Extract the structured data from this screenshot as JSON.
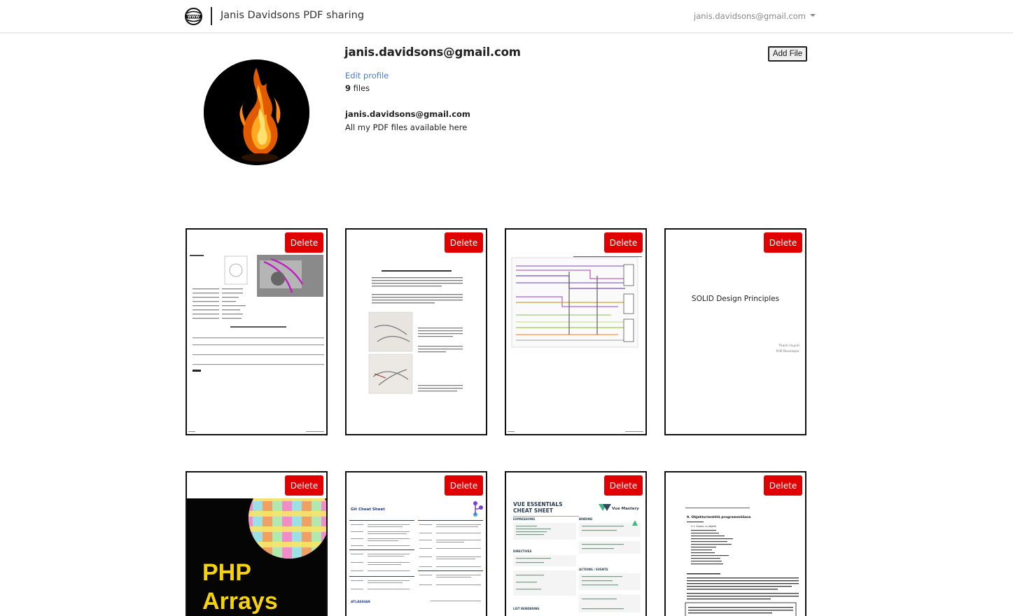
{
  "navbar": {
    "brand_title": "Janis Davidsons PDF sharing",
    "brand_icon": "www-globe-icon",
    "user_menu_label": "janis.davidsons@gmail.com"
  },
  "profile": {
    "email": "janis.davidsons@gmail.com",
    "edit_profile_label": "Edit profile",
    "file_count": "9",
    "file_count_suffix": "files",
    "bio_name": "janis.davidsons@gmail.com",
    "bio_text": "All my PDF files available here",
    "add_file_label": "Add File"
  },
  "files": [
    {
      "delete_label": "Delete",
      "thumb": "connector-datasheet"
    },
    {
      "delete_label": "Delete",
      "thumb": "wiring-harness-tips"
    },
    {
      "delete_label": "Delete",
      "thumb": "wiring-diagram"
    },
    {
      "delete_label": "Delete",
      "thumb": "solid-principles",
      "title_text": "SOLID Design Principles",
      "author_text": "Thanh Huynh",
      "role_text": "PHP Developer"
    },
    {
      "delete_label": "Delete",
      "thumb": "php-arrays",
      "title_line1": "PHP",
      "title_line2": "Arrays"
    },
    {
      "delete_label": "Delete",
      "thumb": "git-cheat-sheet",
      "title_text": "Git Cheat Sheet",
      "footer_text": "ATLASSIAN"
    },
    {
      "delete_label": "Delete",
      "thumb": "vue-cheat-sheet",
      "title_line1": "VUE ESSENTIALS",
      "title_line2": "CHEAT SHEET",
      "brand_text": "Vue Mastery",
      "section1": "EXPRESSIONS",
      "section2": "BINDING",
      "section3": "DIRECTIVES",
      "section4": "ACTIONS / EVENTS",
      "section5": "LIST RENDERING"
    },
    {
      "delete_label": "Delete",
      "thumb": "oop-document",
      "heading_text": "9. Objektorientētā programmēšana",
      "subheading_text": "9.1. Klases un objekti"
    }
  ],
  "colors": {
    "delete_red": "#e00000",
    "link_blue": "#4a7ec9",
    "php_yellow": "#f5d20a",
    "vue_green": "#41b883"
  }
}
